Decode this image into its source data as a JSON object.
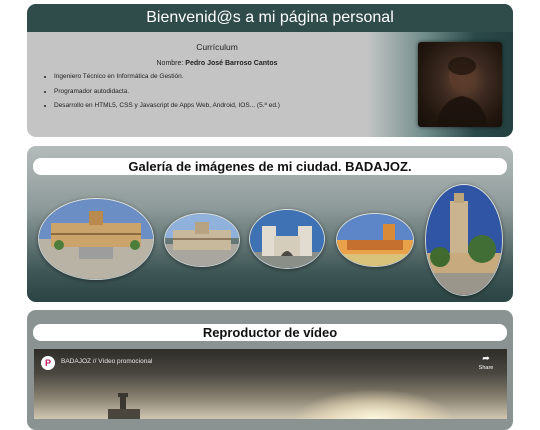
{
  "header": {
    "title": "Bienvenid@s a mi página personal",
    "cv_heading": "Currículum",
    "name_label": "Nombre:",
    "name_value": "Pedro José Barroso Cantos",
    "items": [
      "Ingeniero Técnico en Informática de Gestión.",
      "Programador autodidacta.",
      "Desarrollo en HTML5, CSS y Javascript de Apps Web, Android, IOS... (5.ª ed.)"
    ]
  },
  "gallery": {
    "title": "Galería de imágenes de mi ciudad. BADAJOZ."
  },
  "video": {
    "title": "Reproductor de vídeo",
    "caption": "BADAJOZ // Vídeo promocional",
    "share_label": "Share",
    "share_icon": "share-arrow-icon",
    "logo_letter": "P"
  },
  "colors": {
    "header_bar": "#2f4c4b",
    "card_gray": "#c4c4c4",
    "accent_teal": "#24403f"
  }
}
